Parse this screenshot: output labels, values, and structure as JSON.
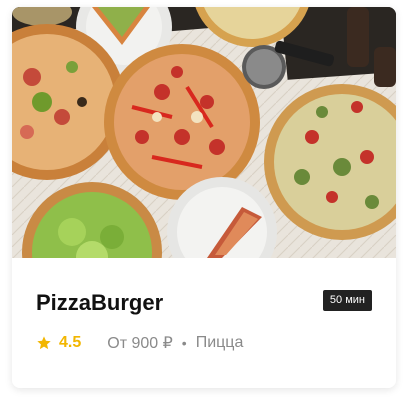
{
  "restaurant": {
    "name": "PizzaBurger",
    "delivery_time": "50 мин",
    "rating": "4.5",
    "price": "От 900 ₽",
    "separator": "•",
    "category": "Пицца",
    "icons": {
      "rating": "star-icon"
    },
    "colors": {
      "rating": "#f2b600",
      "badge_bg": "#222222",
      "muted_text": "#8a8a8a"
    }
  }
}
